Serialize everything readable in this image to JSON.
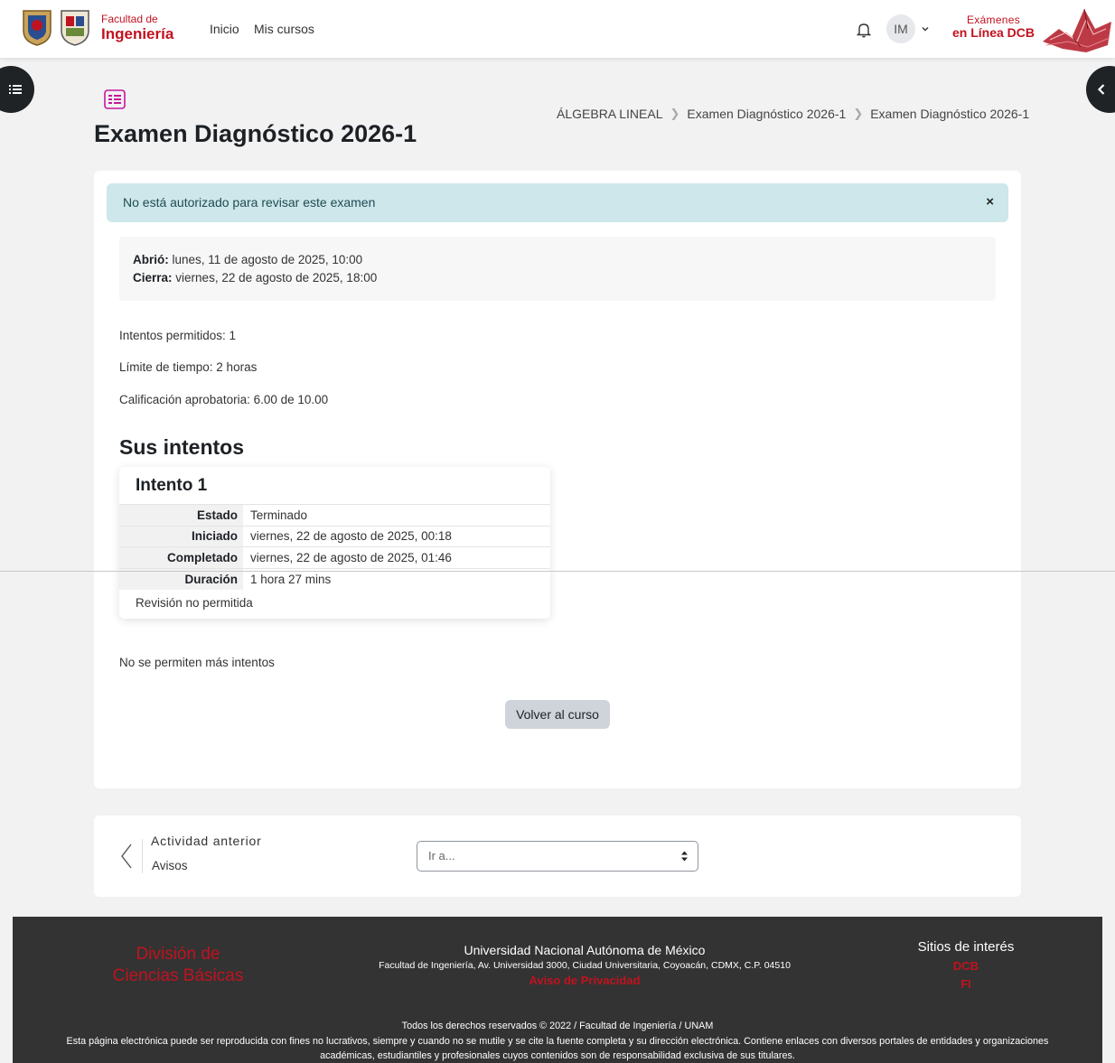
{
  "header": {
    "logo_small": "Facultad de",
    "logo_big": "Ingeniería",
    "nav": [
      "Inicio",
      "Mis cursos"
    ],
    "user_initials": "IM",
    "brand_top": "Exámenes",
    "brand_bottom": "en Línea DCB"
  },
  "page": {
    "title": "Examen Diagnóstico 2026-1",
    "breadcrumb": [
      "ÁLGEBRA LINEAL",
      "Examen Diagnóstico 2026-1",
      "Examen Diagnóstico 2026-1"
    ]
  },
  "alert": {
    "message": "No está autorizado para revisar este examen",
    "close": "×"
  },
  "dates": {
    "open_label": "Abrió:",
    "open_value": "lunes, 11 de agosto de 2025, 10:00",
    "close_label": "Cierra:",
    "close_value": "viernes, 22 de agosto de 2025, 18:00"
  },
  "info": {
    "attempts_allowed": "Intentos permitidos: 1",
    "time_limit": "Límite de tiempo: 2 horas",
    "passing_grade": "Calificación aprobatoria: 6.00 de 10.00"
  },
  "attempts": {
    "heading": "Sus intentos",
    "attempt_title": "Intento 1",
    "rows": [
      {
        "label": "Estado",
        "value": "Terminado"
      },
      {
        "label": "Iniciado",
        "value": "viernes, 22 de agosto de 2025, 00:18"
      },
      {
        "label": "Completado",
        "value": "viernes, 22 de agosto de 2025, 01:46"
      },
      {
        "label": "Duración",
        "value": "1 hora 27 mins"
      }
    ],
    "footer": "Revisión no permitida",
    "no_more": "No se permiten más intentos"
  },
  "back_button": "Volver al curso",
  "activity_nav": {
    "prev_label": "Actividad anterior",
    "prev_link": "Avisos",
    "jump_placeholder": "Ir a..."
  },
  "footer": {
    "dcb_line1": "División de",
    "dcb_line2": "Ciencias Básicas",
    "unam": "Universidad Nacional Autónoma de México",
    "address": "Facultad de Ingeniería, Av. Universidad 3000, Ciudad Universitaria, Coyoacán, CDMX, C.P. 04510",
    "privacy": "Aviso de Privacidad",
    "sites_title": "Sitios de interés",
    "site_links": [
      "DCB",
      "FI"
    ],
    "rights": "Todos los derechos reservados © 2022 / Facultad de Ingeniería / UNAM",
    "disclaimer_1": "Esta página electrónica puede ser reproducida con fines no lucrativos, siempre y cuando no se mutile y se cite la fuente completa y su dirección electrónica. Contiene enlaces con diversos portales de entidades y organizaciones",
    "disclaimer_2": "académicas, estudiantiles y profesionales cuyos contenidos son de responsabilidad exclusiva de sus titulares."
  },
  "colors": {
    "brand_red": "#c1121f",
    "alert_bg": "#cde7ea",
    "footer_bg": "#333333",
    "activity_icon": "#c2189b"
  },
  "icons": [
    "unam-shield-logo",
    "fi-shield-logo",
    "bell-icon",
    "chevron-down-icon",
    "list-icon",
    "chevron-left-icon",
    "quiz-activity-icon",
    "close-icon",
    "select-arrows-icon"
  ]
}
